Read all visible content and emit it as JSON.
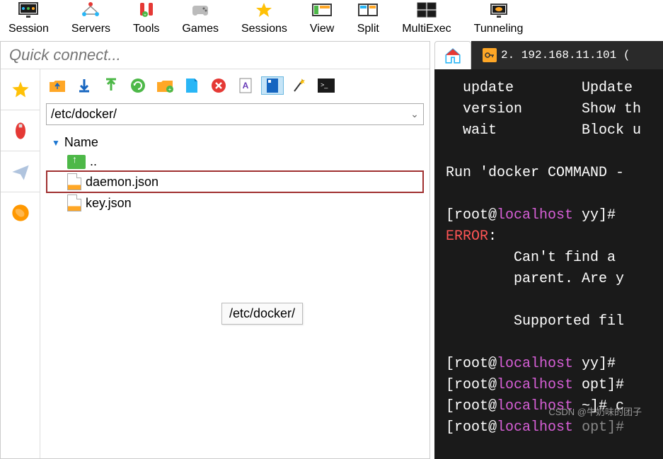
{
  "toolbar": {
    "items": [
      {
        "label": "Session",
        "icon": "session-icon"
      },
      {
        "label": "Servers",
        "icon": "servers-icon"
      },
      {
        "label": "Tools",
        "icon": "tools-icon"
      },
      {
        "label": "Games",
        "icon": "games-icon"
      },
      {
        "label": "Sessions",
        "icon": "sessions-icon"
      },
      {
        "label": "View",
        "icon": "view-icon"
      },
      {
        "label": "Split",
        "icon": "split-icon"
      },
      {
        "label": "MultiExec",
        "icon": "multiexec-icon"
      },
      {
        "label": "Tunneling",
        "icon": "tunneling-icon"
      }
    ]
  },
  "quick_connect": {
    "placeholder": "Quick connect..."
  },
  "path_bar": {
    "value": "/etc/docker/"
  },
  "file_tree": {
    "header": "Name",
    "parent": "..",
    "files": [
      {
        "name": "daemon.json",
        "selected": true
      },
      {
        "name": "key.json",
        "selected": false
      }
    ]
  },
  "tooltip": {
    "text": "/etc/docker/"
  },
  "tabs": {
    "terminal_label": "2. 192.168.11.101 ("
  },
  "terminal": {
    "lines": [
      {
        "parts": [
          {
            "t": "  update        Update ",
            "c": ""
          }
        ]
      },
      {
        "parts": [
          {
            "t": "  version       Show th",
            "c": ""
          }
        ]
      },
      {
        "parts": [
          {
            "t": "  wait          Block u",
            "c": ""
          }
        ]
      },
      {
        "parts": [
          {
            "t": "",
            "c": ""
          }
        ]
      },
      {
        "parts": [
          {
            "t": "Run 'docker COMMAND -",
            "c": ""
          }
        ]
      },
      {
        "parts": [
          {
            "t": "",
            "c": ""
          }
        ]
      },
      {
        "parts": [
          {
            "t": "[root@",
            "c": ""
          },
          {
            "t": "localhost",
            "c": "t-magenta"
          },
          {
            "t": " yy]# ",
            "c": ""
          }
        ]
      },
      {
        "parts": [
          {
            "t": "ERROR",
            "c": "t-red"
          },
          {
            "t": ":",
            "c": ""
          }
        ]
      },
      {
        "parts": [
          {
            "t": "        Can't find a ",
            "c": ""
          }
        ]
      },
      {
        "parts": [
          {
            "t": "        parent. Are y",
            "c": ""
          }
        ]
      },
      {
        "parts": [
          {
            "t": "",
            "c": ""
          }
        ]
      },
      {
        "parts": [
          {
            "t": "        Supported fil",
            "c": ""
          }
        ]
      },
      {
        "parts": [
          {
            "t": "",
            "c": ""
          }
        ]
      },
      {
        "parts": [
          {
            "t": "[root@",
            "c": ""
          },
          {
            "t": "localhost",
            "c": "t-magenta"
          },
          {
            "t": " yy]# ",
            "c": ""
          }
        ]
      },
      {
        "parts": [
          {
            "t": "[root@",
            "c": ""
          },
          {
            "t": "localhost",
            "c": "t-magenta"
          },
          {
            "t": " opt]#",
            "c": ""
          }
        ]
      },
      {
        "parts": [
          {
            "t": "[root@",
            "c": ""
          },
          {
            "t": "localhost",
            "c": "t-magenta"
          },
          {
            "t": " ~]# c",
            "c": ""
          }
        ]
      },
      {
        "parts": [
          {
            "t": "[root@",
            "c": ""
          },
          {
            "t": "localhost",
            "c": "t-magenta"
          },
          {
            "t": " ",
            "c": ""
          },
          {
            "t": "opt]#",
            "c": "t-gray"
          }
        ]
      }
    ]
  },
  "watermark": "CSDN @牛奶味的团子",
  "colors": {
    "accent_orange": "#ffa726",
    "accent_blue": "#29b6f6",
    "accent_green": "#4db848",
    "accent_red": "#e53935"
  }
}
